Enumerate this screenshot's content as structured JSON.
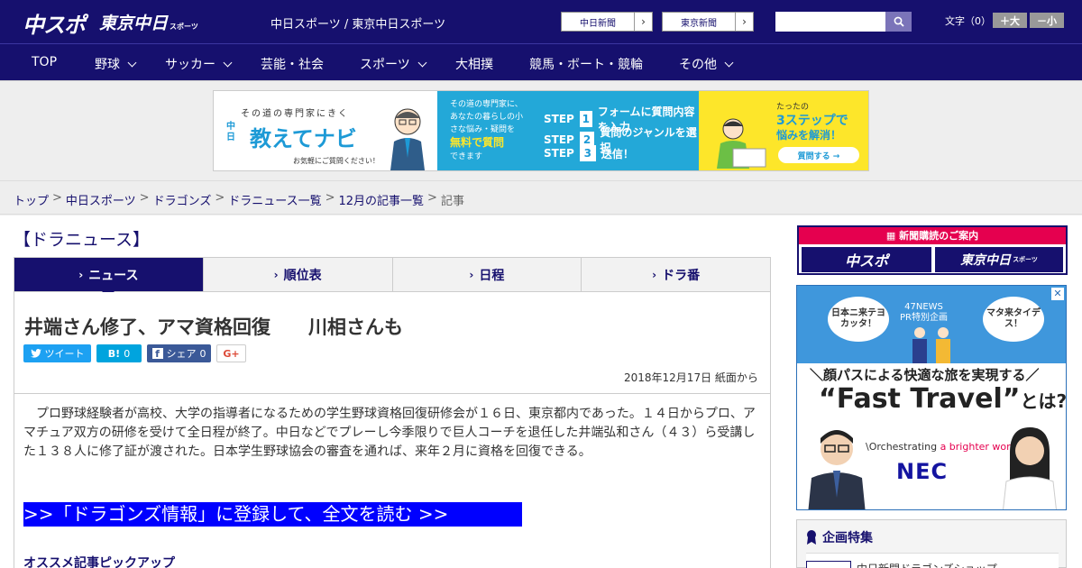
{
  "header": {
    "logo_chuspo": "中スポ",
    "logo_tokyo": "東京中日",
    "logo_tokyo_small": "スポーツ",
    "site_name": "中日スポーツ / 東京中日スポーツ",
    "paper_buttons": [
      "中日新聞",
      "東京新聞"
    ],
    "search_placeholder": "",
    "font_size_label": "文字（0）",
    "font_large": "＋大",
    "font_small": "－小"
  },
  "nav": {
    "items": [
      {
        "label": "TOP",
        "has_menu": false
      },
      {
        "label": "野球",
        "has_menu": true
      },
      {
        "label": "サッカー",
        "has_menu": true
      },
      {
        "label": "芸能・社会",
        "has_menu": false
      },
      {
        "label": "スポーツ",
        "has_menu": true
      },
      {
        "label": "大相撲",
        "has_menu": false
      },
      {
        "label": "競馬・ボート・競輪",
        "has_menu": false
      },
      {
        "label": "その他",
        "has_menu": true
      }
    ]
  },
  "banner": {
    "tag": "その道の専門家にきく",
    "brand_small": "中日",
    "title": "教えてナビ",
    "sub": "お気軽にご質問ください！",
    "mid_text": "その道の専門家に、あなたの暮らしの小さな悩み・疑問を",
    "mid_highlight": "無料で質問",
    "mid_end": "できます",
    "steps": [
      {
        "label": "STEP",
        "num": "1",
        "text": "フォームに質問内容を入力"
      },
      {
        "label": "STEP",
        "num": "2",
        "text": "質問のジャンルを選択"
      },
      {
        "label": "STEP",
        "num": "3",
        "text": "送信！"
      }
    ],
    "right_small": "たったの",
    "right_big": "3ステップで",
    "right_line": "悩みを解消！",
    "right_button": "質問する →"
  },
  "breadcrumb": {
    "items": [
      "トップ",
      "中日スポーツ",
      "ドラゴンズ",
      "ドラニュース一覧",
      "12月の記事一覧",
      "記事"
    ],
    "sep": ">"
  },
  "section_title": "【ドラニュース】",
  "tabs": [
    {
      "label": "ニュース",
      "active": true
    },
    {
      "label": "順位表",
      "active": false
    },
    {
      "label": "日程",
      "active": false
    },
    {
      "label": "ドラ番",
      "active": false
    }
  ],
  "article": {
    "title": "井端さん修了、アマ資格回復　　川相さんも",
    "social": {
      "tweet": "ツイート",
      "hatena": "B!",
      "hatena_count": "0",
      "share": "シェア",
      "share_count": "0",
      "gplus": "G+"
    },
    "date": "2018年12月17日 紙面から",
    "body": "　プロ野球経験者が高校、大学の指導者になるための学生野球資格回復研修会が１６日、東京都内であった。１４日からプロ、アマチュア双方の研修を受けて全日程が終了。中日などでプレーし今季限りで巨人コーチを退任した井端弘和さん（４３）ら受講した１３８人に修了証が渡された。日本学生野球協会の審査を通れば、来年２月に資格を回復できる。",
    "cta": ">>「ドラゴンズ情報」に登録して、全文を読む >>",
    "pickup": "オススメ記事ピックアップ"
  },
  "sidebar": {
    "subscribe_head": "新聞購読のご案内",
    "subscribe_logos": [
      "中スポ",
      "東京中日"
    ],
    "subscribe_logo_small": "スポーツ",
    "ad": {
      "bubble1": "日本ニ来テヨカッタ！",
      "bubble2": "マタ来タイデス！",
      "pr": "47NEWS\nPR特別企画",
      "line1": "＼顔パスによる快適な旅を実現する／",
      "line2": "“Fast Travel”",
      "line2_suffix": "とは?",
      "orch_prefix": "\\Orchestrating",
      "orch_colored": "a brighter world",
      "nec": "NEC",
      "close": "✕"
    },
    "feature_title": "企画特集",
    "feature_item": "中日新聞ドラゴンズショップ"
  },
  "colors": {
    "brand": "#16106e",
    "cta": "#0000ff",
    "accent_red": "#e5004f",
    "twitter": "#1da1f2",
    "hatena": "#00a4de",
    "facebook": "#3b5998"
  },
  "icons": {
    "search": "search-icon",
    "chevron": "chevron-right-icon",
    "bird": "twitter-icon",
    "fb": "facebook-icon"
  }
}
